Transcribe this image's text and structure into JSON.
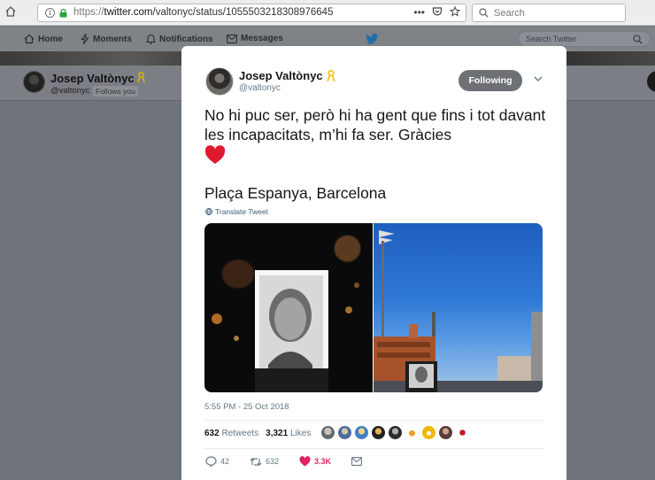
{
  "browser": {
    "url_scheme": "https://",
    "url_host": "twitter.com",
    "url_path": "/valtonyc/status/1055503218308976645",
    "search_placeholder": "Search",
    "more_label": "•••"
  },
  "nav": {
    "home": "Home",
    "moments": "Moments",
    "notifications": "Notifications",
    "messages": "Messages",
    "search_placeholder": "Search Twitter"
  },
  "profile": {
    "name": "Josep Valtònyc",
    "handle": "@valtonyc",
    "follows_you": "Follows you"
  },
  "tweet": {
    "author_name": "Josep Valtònyc",
    "author_handle": "@valtonyc",
    "follow_label": "Following",
    "text": "No hi puc ser, però hi ha gent que fins i tot davant les incapacitats, m’hi fa ser. Gràcies",
    "location_text": "Plaça Espanya, Barcelona",
    "translate_label": "Translate Tweet",
    "timestamp": "5:55 PM - 25 Oct 2018",
    "retweets_count": "632",
    "retweets_label": "Retweets",
    "likes_count": "3,321",
    "likes_label": "Likes",
    "replies": "42",
    "retweets_action": "632",
    "likes_action": "3.3K"
  },
  "colors": {
    "link_blue": "#3d5c7a",
    "like_red": "#e0245e",
    "ribbon_yellow": "#f5c518",
    "twitter_blue": "#1da1f2"
  }
}
